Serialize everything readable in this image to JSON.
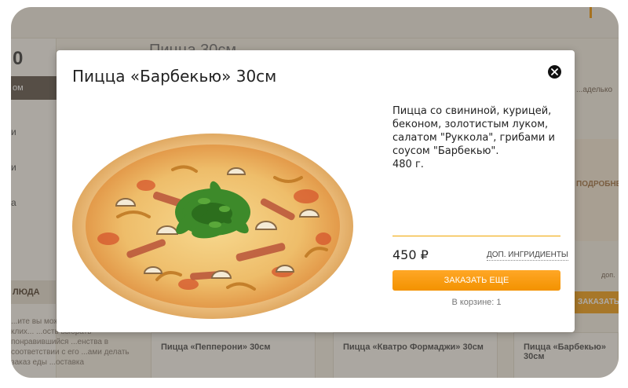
{
  "modal": {
    "title": "Пицца «Барбекью» 30см",
    "description": "Пицца со свининой, курицей, беконом, золотистым луком, салатом \"Руккола\", грибами и соусом \"Барбекью\".",
    "weight": "480 г.",
    "price": "450 ₽",
    "extra_ingredients_link": "ДОП. ИНГРИДИЕНТЫ",
    "order_button": "ЗАКАЗАТЬ ЕЩЕ",
    "cart_note": "В корзине: 1",
    "close_icon": "close-icon",
    "accent_color": "#f39200"
  },
  "background": {
    "header_digit": "0",
    "left_button": "ом",
    "heading": "Пицца 30см",
    "side_letters": [
      "и",
      "и",
      "а"
    ],
    "side_tab": "ЛЮДА",
    "side_text": "...ите вы може... ...аете дом клих... ...ость выбрать понравившийся ...енства в соответствии с его ...ами делать заказ еды ...оставка",
    "cards": [
      "Пицца «Пепперони» 30см",
      "Пицца «Кватро Формаджи» 30см",
      "Пицца «Барбекью» 30см"
    ],
    "right_label": "...аделько",
    "right_card_label": "ПОДРОБНЕЕ",
    "right_small": "доп.",
    "right_order": "ЗАКАЗАТЬ"
  }
}
